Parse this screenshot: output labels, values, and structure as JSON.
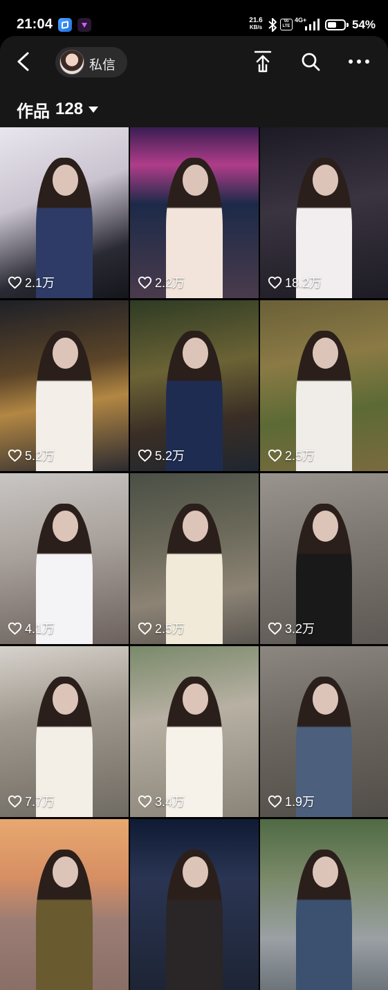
{
  "status_bar": {
    "time": "21:04",
    "net_speed_value": "21.6",
    "net_speed_unit": "KB/s",
    "volte_top": "Vo",
    "volte_bottom": "LTE",
    "network": "4G+",
    "battery_percent": "54%",
    "battery_level": 0.54
  },
  "header": {
    "dm_label": "私信",
    "works_label": "作品",
    "works_count": "128"
  },
  "icons": {
    "back": "chevron-left-icon",
    "share": "upload-icon",
    "search": "search-icon",
    "more": "more-dots-icon",
    "like": "heart-icon"
  },
  "grid": {
    "tiles": [
      {
        "likes": "2.1万",
        "bg": "linear-gradient(160deg,#e9e6ee 0%,#c9c3cf 40%,#2a2a34 75%,#15151c 100%)",
        "outfit": "#2e3b66"
      },
      {
        "likes": "2.2万",
        "bg": "linear-gradient(180deg,#3a1d52 0%,#b03d8a 22%,#1c2a48 45%,#4a3b4c 100%)",
        "outfit": "#f2e4da"
      },
      {
        "likes": "18.2万",
        "bg": "linear-gradient(170deg,#1c1a25 0%,#3a3340 45%,#1d1c24 100%)",
        "outfit": "#f2eef0"
      },
      {
        "likes": "5.2万",
        "bg": "linear-gradient(170deg,#1e2027 0%,#5c4529 40%,#b38743 60%,#2b2a30 100%)",
        "outfit": "#f3eee8"
      },
      {
        "likes": "5.2万",
        "bg": "linear-gradient(170deg,#2e3b24 0%,#6b6335 40%,#3a2e25 70%,#1f2630 100%)",
        "outfit": "#1f2c52"
      },
      {
        "likes": "2.5万",
        "bg": "linear-gradient(170deg,#6a6038 0%,#8b7a45 35%,#5c6a35 65%,#7a6a40 100%)",
        "outfit": "#f0ede8"
      },
      {
        "likes": "4.1万",
        "bg": "linear-gradient(170deg,#c9c6c4 0%,#a8a09a 45%,#6c615c 100%)",
        "outfit": "#f4f4f6"
      },
      {
        "likes": "2.5万",
        "bg": "linear-gradient(170deg,#4a4f45 0%,#6c6a5a 40%,#8c8375 70%,#5a5650 100%)",
        "outfit": "#f2ead8"
      },
      {
        "likes": "3.2万",
        "bg": "linear-gradient(170deg,#9a948e 0%,#7c7670 45%,#5d5853 100%)",
        "outfit": "#191919"
      },
      {
        "likes": "7.7万",
        "bg": "linear-gradient(170deg,#d7d2cc 0%,#a0998f 40%,#6f6a62 100%)",
        "outfit": "#f3efe6"
      },
      {
        "likes": "3.4万",
        "bg": "linear-gradient(170deg,#7a8a6a 0%,#b7b0a3 40%,#8a8478 100%)",
        "outfit": "#f6f2ea"
      },
      {
        "likes": "1.9万",
        "bg": "linear-gradient(170deg,#8c8780 0%,#6c6760 45%,#514d48 100%)",
        "outfit": "#4c5f7c"
      },
      {
        "likes": "",
        "bg": "linear-gradient(180deg,#e8a86f 0%,#d68e63 35%,#9b7d74 60%,#8a6f66 100%)",
        "outfit": "#6a5a30"
      },
      {
        "likes": "",
        "bg": "linear-gradient(180deg,#0f1b34 0%,#2a3553 35%,#1d2434 100%)",
        "outfit": "#2a2526"
      },
      {
        "likes": "",
        "bg": "linear-gradient(180deg,#4f6a44 0%,#7b8a6a 35%,#9aa0a4 70%,#6d747a 100%)",
        "outfit": "#3c5070"
      }
    ]
  }
}
